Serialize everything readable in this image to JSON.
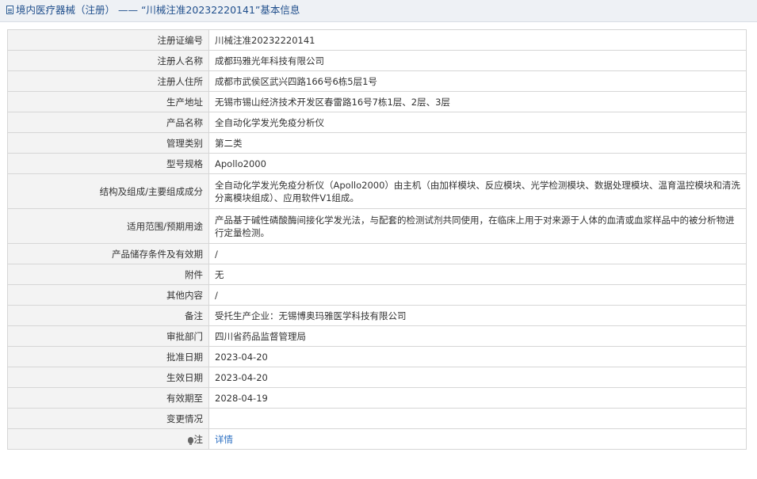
{
  "header": {
    "title": "境内医疗器械（注册） —— “川械注准20232220141”基本信息",
    "icon": "document-icon"
  },
  "rows": [
    {
      "label": "注册证编号",
      "value": "川械注准20232220141"
    },
    {
      "label": "注册人名称",
      "value": "成都玛雅光年科技有限公司"
    },
    {
      "label": "注册人住所",
      "value": "成都市武侯区武兴四路166号6栋5层1号"
    },
    {
      "label": "生产地址",
      "value": "无锡市锡山经济技术开发区春雷路16号7栋1层、2层、3层"
    },
    {
      "label": "产品名称",
      "value": "全自动化学发光免疫分析仪"
    },
    {
      "label": "管理类别",
      "value": "第二类"
    },
    {
      "label": "型号规格",
      "value": "Apollo2000"
    },
    {
      "label": "结构及组成/主要组成成分",
      "value": "全自动化学发光免疫分析仪（Apollo2000）由主机（由加样模块、反应模块、光学检测模块、数据处理模块、温育温控模块和清洗分离模块组成）、应用软件V1组成。"
    },
    {
      "label": "适用范围/预期用途",
      "value": "产品基于碱性磷酸酶间接化学发光法，与配套的检测试剂共同使用，在临床上用于对来源于人体的血清或血浆样品中的被分析物进行定量检测。"
    },
    {
      "label": "产品储存条件及有效期",
      "value": "/"
    },
    {
      "label": "附件",
      "value": "无"
    },
    {
      "label": "其他内容",
      "value": "/"
    },
    {
      "label": "备注",
      "value": "受托生产企业：无锡博奥玛雅医学科技有限公司"
    },
    {
      "label": "审批部门",
      "value": "四川省药品监督管理局"
    },
    {
      "label": "批准日期",
      "value": "2023-04-20"
    },
    {
      "label": "生效日期",
      "value": "2023-04-20"
    },
    {
      "label": "有效期至",
      "value": "2028-04-19"
    },
    {
      "label": "变更情况",
      "value": ""
    }
  ],
  "note": {
    "label": "注",
    "icon": "lightbulb-icon",
    "link": "详情"
  }
}
